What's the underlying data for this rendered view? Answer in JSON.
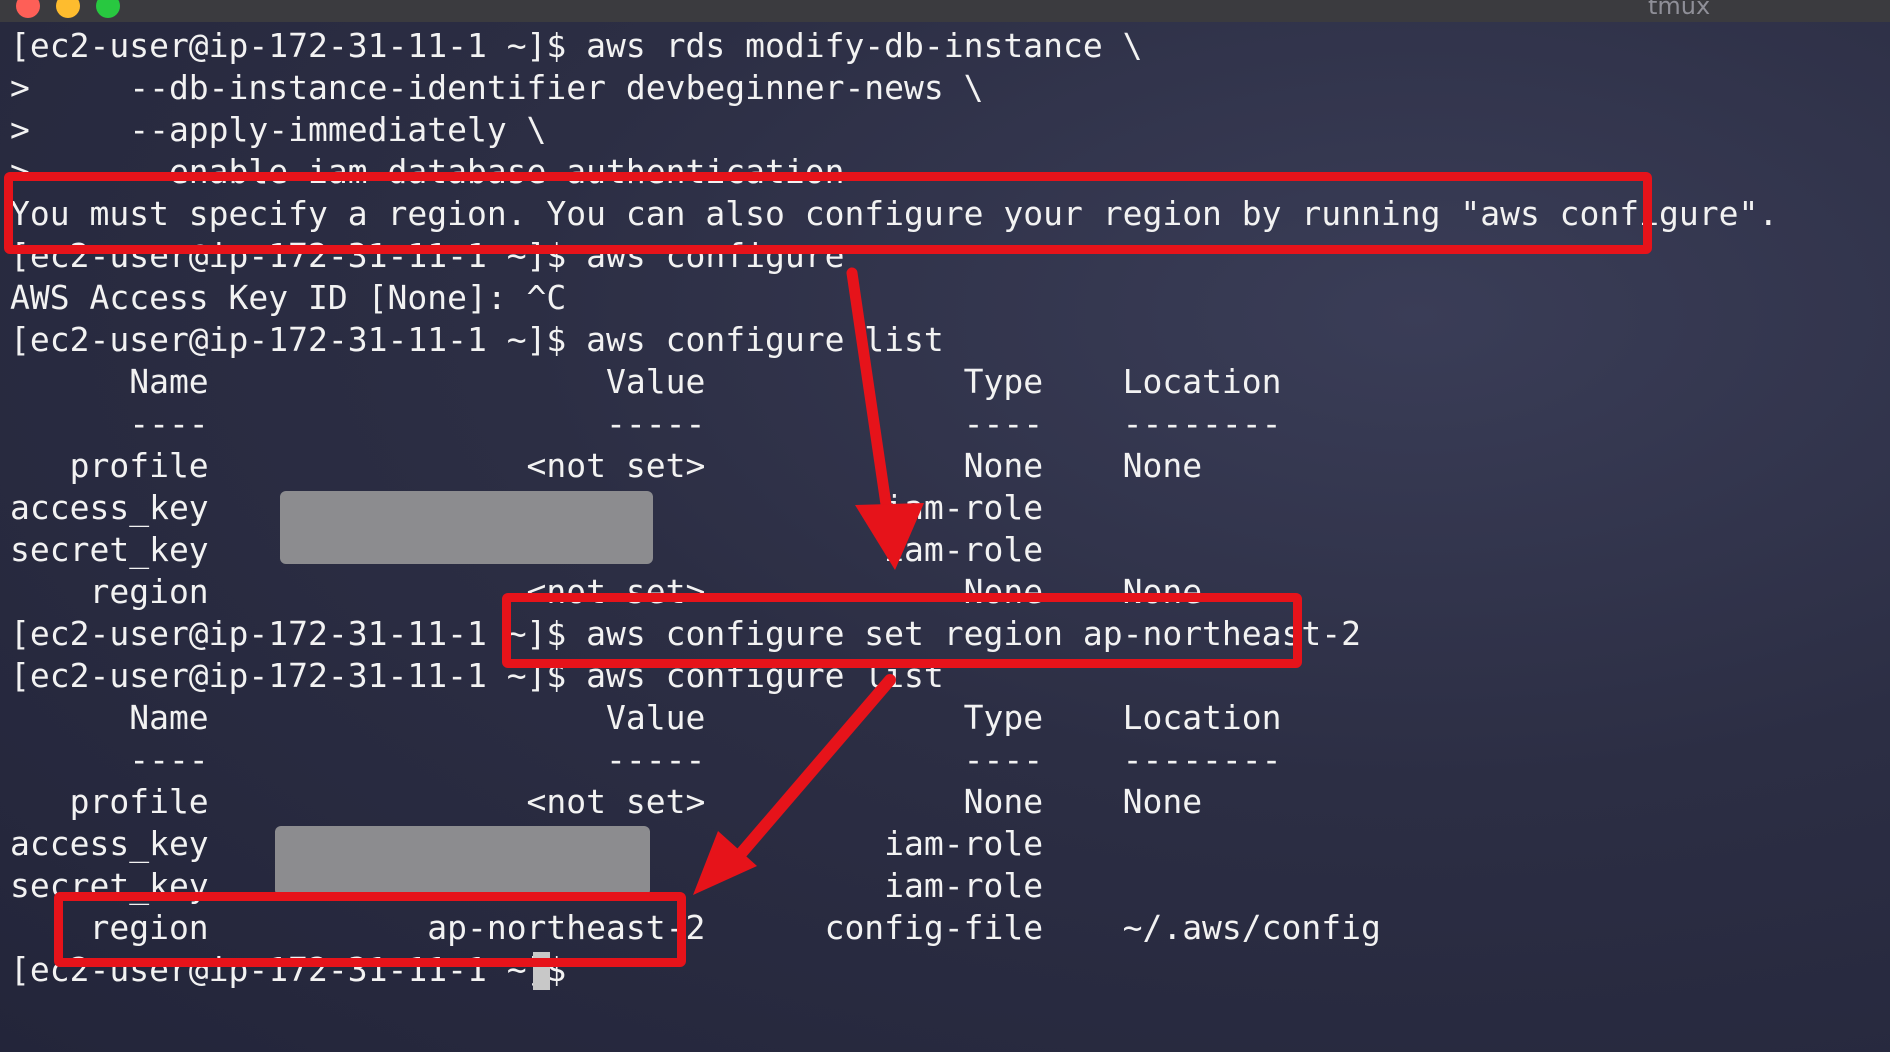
{
  "window": {
    "title": "tmux"
  },
  "terminal": {
    "lines": [
      "[ec2-user@ip-172-31-11-1 ~]$ aws rds modify-db-instance \\",
      ">     --db-instance-identifier devbeginner-news \\",
      ">     --apply-immediately \\",
      ">     --enable-iam-database-authentication",
      "You must specify a region. You can also configure your region by running \"aws configure\".",
      "[ec2-user@ip-172-31-11-1 ~]$ aws configure",
      "AWS Access Key ID [None]: ^C",
      "[ec2-user@ip-172-31-11-1 ~]$ aws configure list",
      "      Name                    Value             Type    Location",
      "      ----                    -----             ----    --------",
      "   profile                <not set>             None    None",
      "access_key                                  iam-role",
      "secret_key                                  iam-role",
      "    region                <not set>             None    None",
      "[ec2-user@ip-172-31-11-1 ~]$ aws configure set region ap-northeast-2",
      "[ec2-user@ip-172-31-11-1 ~]$ aws configure list",
      "      Name                    Value             Type    Location",
      "      ----                    -----             ----    --------",
      "   profile                <not set>             None    None",
      "access_key                                  iam-role",
      "secret_key                                  iam-role",
      "    region           ap-northeast-2      config-file    ~/.aws/config",
      "[ec2-user@ip-172-31-11-1 ~]$ "
    ]
  },
  "colors": {
    "background": "#2c2e44",
    "text": "#f2f2f2",
    "highlight": "#e6131a",
    "redaction": "#8c8c8f"
  }
}
